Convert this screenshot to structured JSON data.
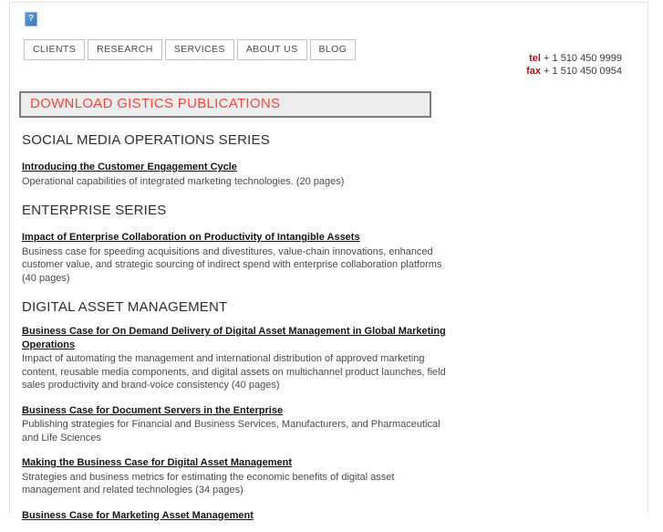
{
  "logo": {
    "glyph": "?"
  },
  "nav": {
    "items": [
      {
        "label": "CLIENTS"
      },
      {
        "label": "RESEARCH"
      },
      {
        "label": "SERVICES"
      },
      {
        "label": "ABOUT US"
      },
      {
        "label": "BLOG"
      }
    ]
  },
  "contact": {
    "tel_label": "tel",
    "tel_value": "+ 1 510 450 9999",
    "fax_label": "fax",
    "fax_value": "+ 1 510 450 0954",
    "label_color": "#b5121b"
  },
  "header": {
    "title": "DOWNLOAD GISTICS PUBLICATIONS",
    "title_color": "#f9453f",
    "box_background": "#ededed",
    "box_border": "#7e7e7e"
  },
  "sections": [
    {
      "heading": "SOCIAL MEDIA OPERATIONS SERIES",
      "publications": [
        {
          "title": "Introducing the Customer Engagement Cycle",
          "description": "Operational capabilities of integrated marketing technologies. (20 pages)"
        }
      ]
    },
    {
      "heading": "ENTERPRISE SERIES",
      "publications": [
        {
          "title": "Impact of Enterprise Collaboration on Productivity of Intangible Assets",
          "description": "Business case for speeding acquisitions and divestitures, value-chain innovations, enhanced\ncustomer value, and strategic sourcing of indirect spend with enterprise collaboration platforms\n(40 pages)"
        }
      ]
    },
    {
      "heading": "DIGITAL ASSET MANAGEMENT",
      "publications": [
        {
          "title": "Business Case for On Demand Delivery of Digital Asset Management in Global Marketing\nOperations",
          "description": "Impact of automating the management and international distribution of approved marketing\ncontent, reusable media components, and digital assets on multichannel product launches, field\nsales productivity and brand-voice consistency (40 pages)"
        },
        {
          "title": "Business Case for Document Servers in the Enterprise",
          "description": "Publishing strategies for Financial and Business Services, Manufacturers, and Pharmaceutical\nand Life Sciences"
        },
        {
          "title": "Making the Business Case for Digital Asset Management",
          "description": "Strategies and business metrics for estimating the economic benefits of digital asset\nmanagement and related technologies (34 pages)"
        }
      ]
    }
  ],
  "partial_publication": {
    "title": "Business Case for Marketing Asset Management"
  }
}
